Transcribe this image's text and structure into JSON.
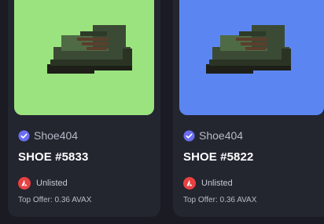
{
  "cards": [
    {
      "bg_color": "#9be37f",
      "collection": "Shoe404",
      "title": "SHOE #5833",
      "status": "Unlisted",
      "offer_label": "Top Offer:",
      "offer_value": "0.36 AVAX"
    },
    {
      "bg_color": "#5b86f2",
      "collection": "Shoe404",
      "title": "SHOE #5822",
      "status": "Unlisted",
      "offer_label": "Top Offer:",
      "offer_value": "0.36 AVAX"
    }
  ],
  "colors": {
    "verified_badge": "#6b6ef0",
    "avax_red": "#e84142",
    "shoe_dark": "#3b4a34",
    "shoe_mid": "#4f6b45",
    "shoe_sole": "#1d1f18"
  },
  "icons": {
    "verified": "verified-badge-icon",
    "avax": "avalanche-icon"
  }
}
